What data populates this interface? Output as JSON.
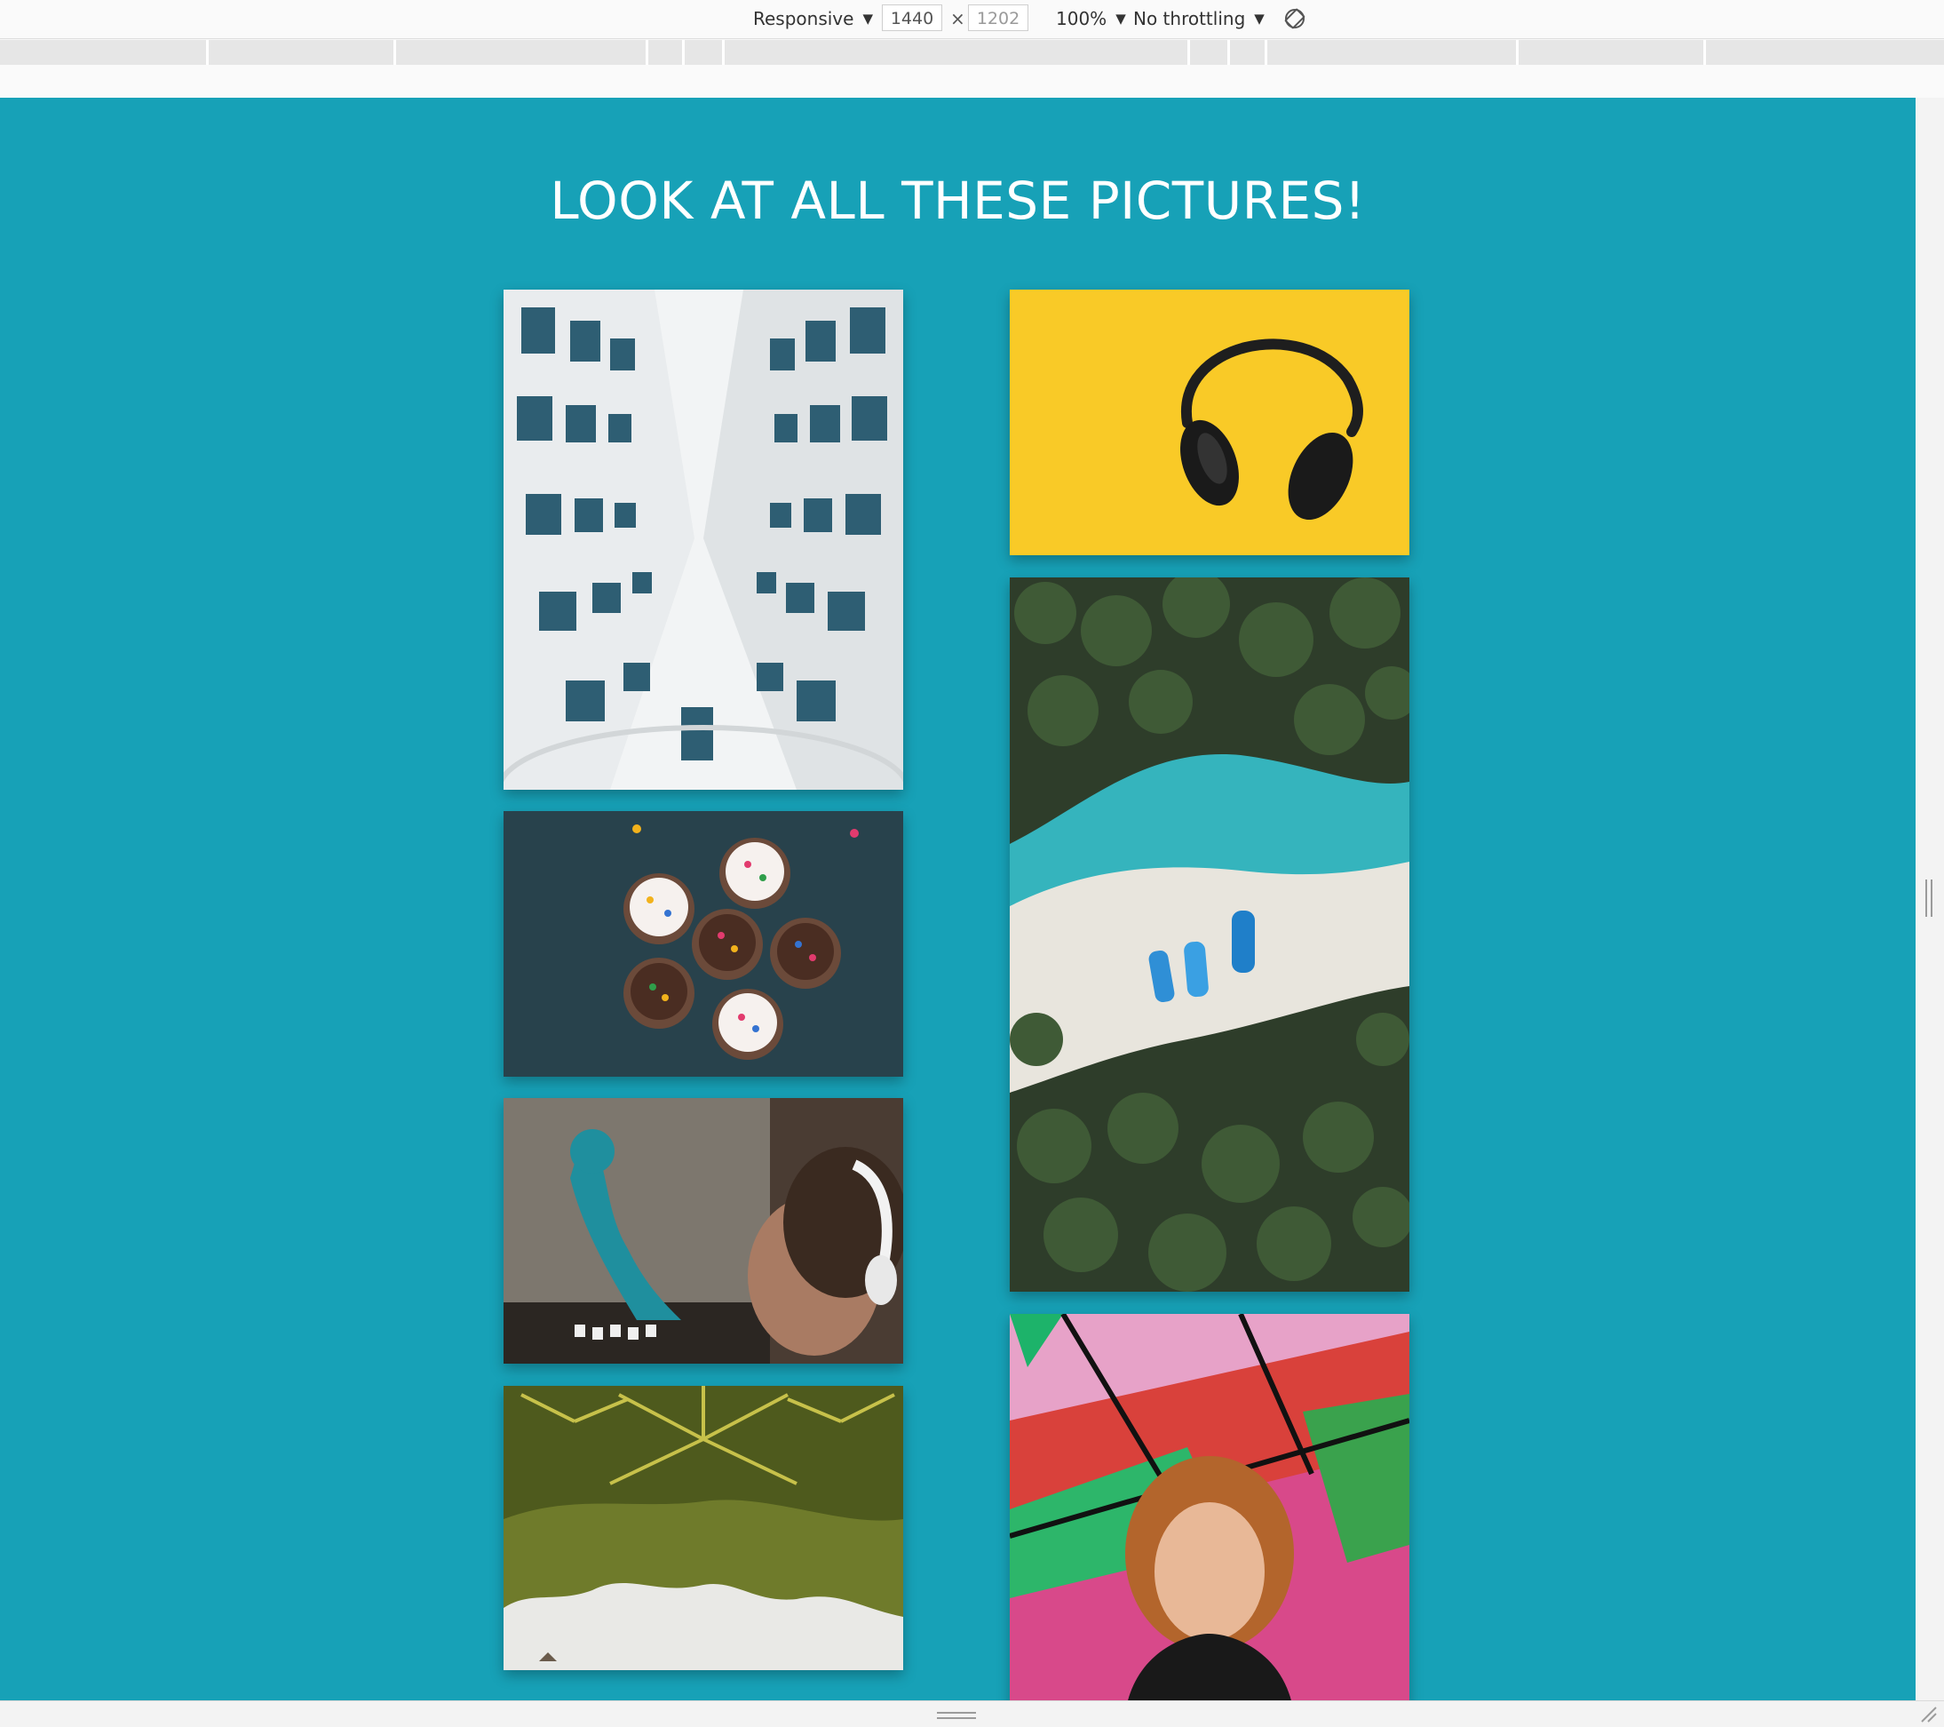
{
  "devtools": {
    "device_mode": "Responsive",
    "width": "1440",
    "height": "1202",
    "times": "×",
    "zoom": "100%",
    "throttling": "No throttling"
  },
  "page": {
    "background": "#17a1b7",
    "title": "LOOK AT ALL THESE PICTURES!"
  },
  "gallery": {
    "left_column": [
      "building-photo",
      "cupcakes-photo",
      "graffiti-headphones-photo",
      "palm-trees-photo"
    ],
    "right_column": [
      "headphones-photo",
      "aerial-beach-photo",
      "girl-graffiti-photo"
    ]
  }
}
